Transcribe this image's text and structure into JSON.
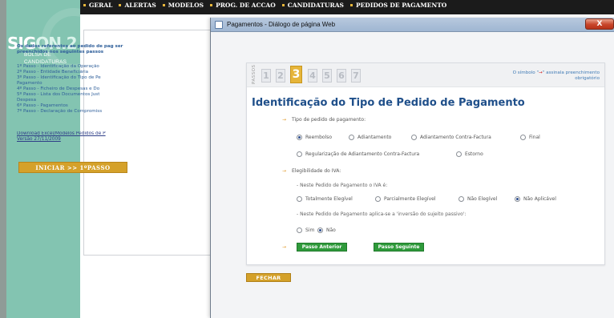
{
  "app": {
    "logo_main": "SIG",
    "logo_on": "ON.2",
    "logo_sub": "BOLSA DE CANDIDATURAS"
  },
  "nav": {
    "items": [
      "GERAL",
      "ALERTAS",
      "MODELOS",
      "PROG. DE ACCAO",
      "CANDIDATURAS",
      "PEDIDOS DE PAGAMENTO"
    ]
  },
  "sidebar_content": {
    "intro": "Os dados referentes ao pedido de pag ser preenchidos nos seguintes passos",
    "steps": [
      "1º Passo - Identificação da Operação",
      "2º Passo - Entidade Beneficiária",
      "3º Passo - Identificação do Tipo de Pe",
      "Pagamento",
      "4º Passo - Ficheiro de Despesas e Do",
      "5º Passo - Lista dos Documentos Just",
      "Despesa",
      "6º Passo - Pagamentos",
      "7º Passo - Declaração de Compromiss"
    ],
    "download_link": "Download Excel/Modelos Pedidos de P",
    "version": "Versão 27/11/2009",
    "start_button": "INICIAR >> 1ºPASSO"
  },
  "dialog": {
    "title": "Pagamentos - Diálogo de página Web",
    "close_label": "X",
    "passos_label": "PASSOS",
    "steps": [
      "1",
      "2",
      "3",
      "4",
      "5",
      "6",
      "7"
    ],
    "active_step": 3,
    "mandatory_note_prefix": "O símbolo \"",
    "mandatory_note_symbol": "→",
    "mandatory_note_suffix": "\" assinala preenchimento obrigatório",
    "form_title": "Identificação do Tipo de Pedido de Pagamento",
    "q1": {
      "label": "Tipo de pedido de pagamento:",
      "options": [
        "Reembolso",
        "Adiantamento",
        "Adiantamento Contra-Factura",
        "Final",
        "Regularização de Adiantamento Contra-Factura",
        "Estorno"
      ],
      "selected": "Reembolso"
    },
    "q2": {
      "label": "Elegibilidade do IVA:",
      "sub1": "- Neste Pedido de Pagamento o IVA é:",
      "options1": [
        "Totalmente Elegível",
        "Parcialmente Elegível",
        "Não Elegível",
        "Não Aplicável"
      ],
      "selected1": "Não Aplicável",
      "sub2": "- Neste Pedido de Pagamento aplica-se a 'inversão do sujeito passivo':",
      "options2": [
        "Sim",
        "Não"
      ],
      "selected2": "Não"
    },
    "btn_prev": "Passo Anterior",
    "btn_next": "Passo Seguinte",
    "btn_close": "FECHAR"
  }
}
